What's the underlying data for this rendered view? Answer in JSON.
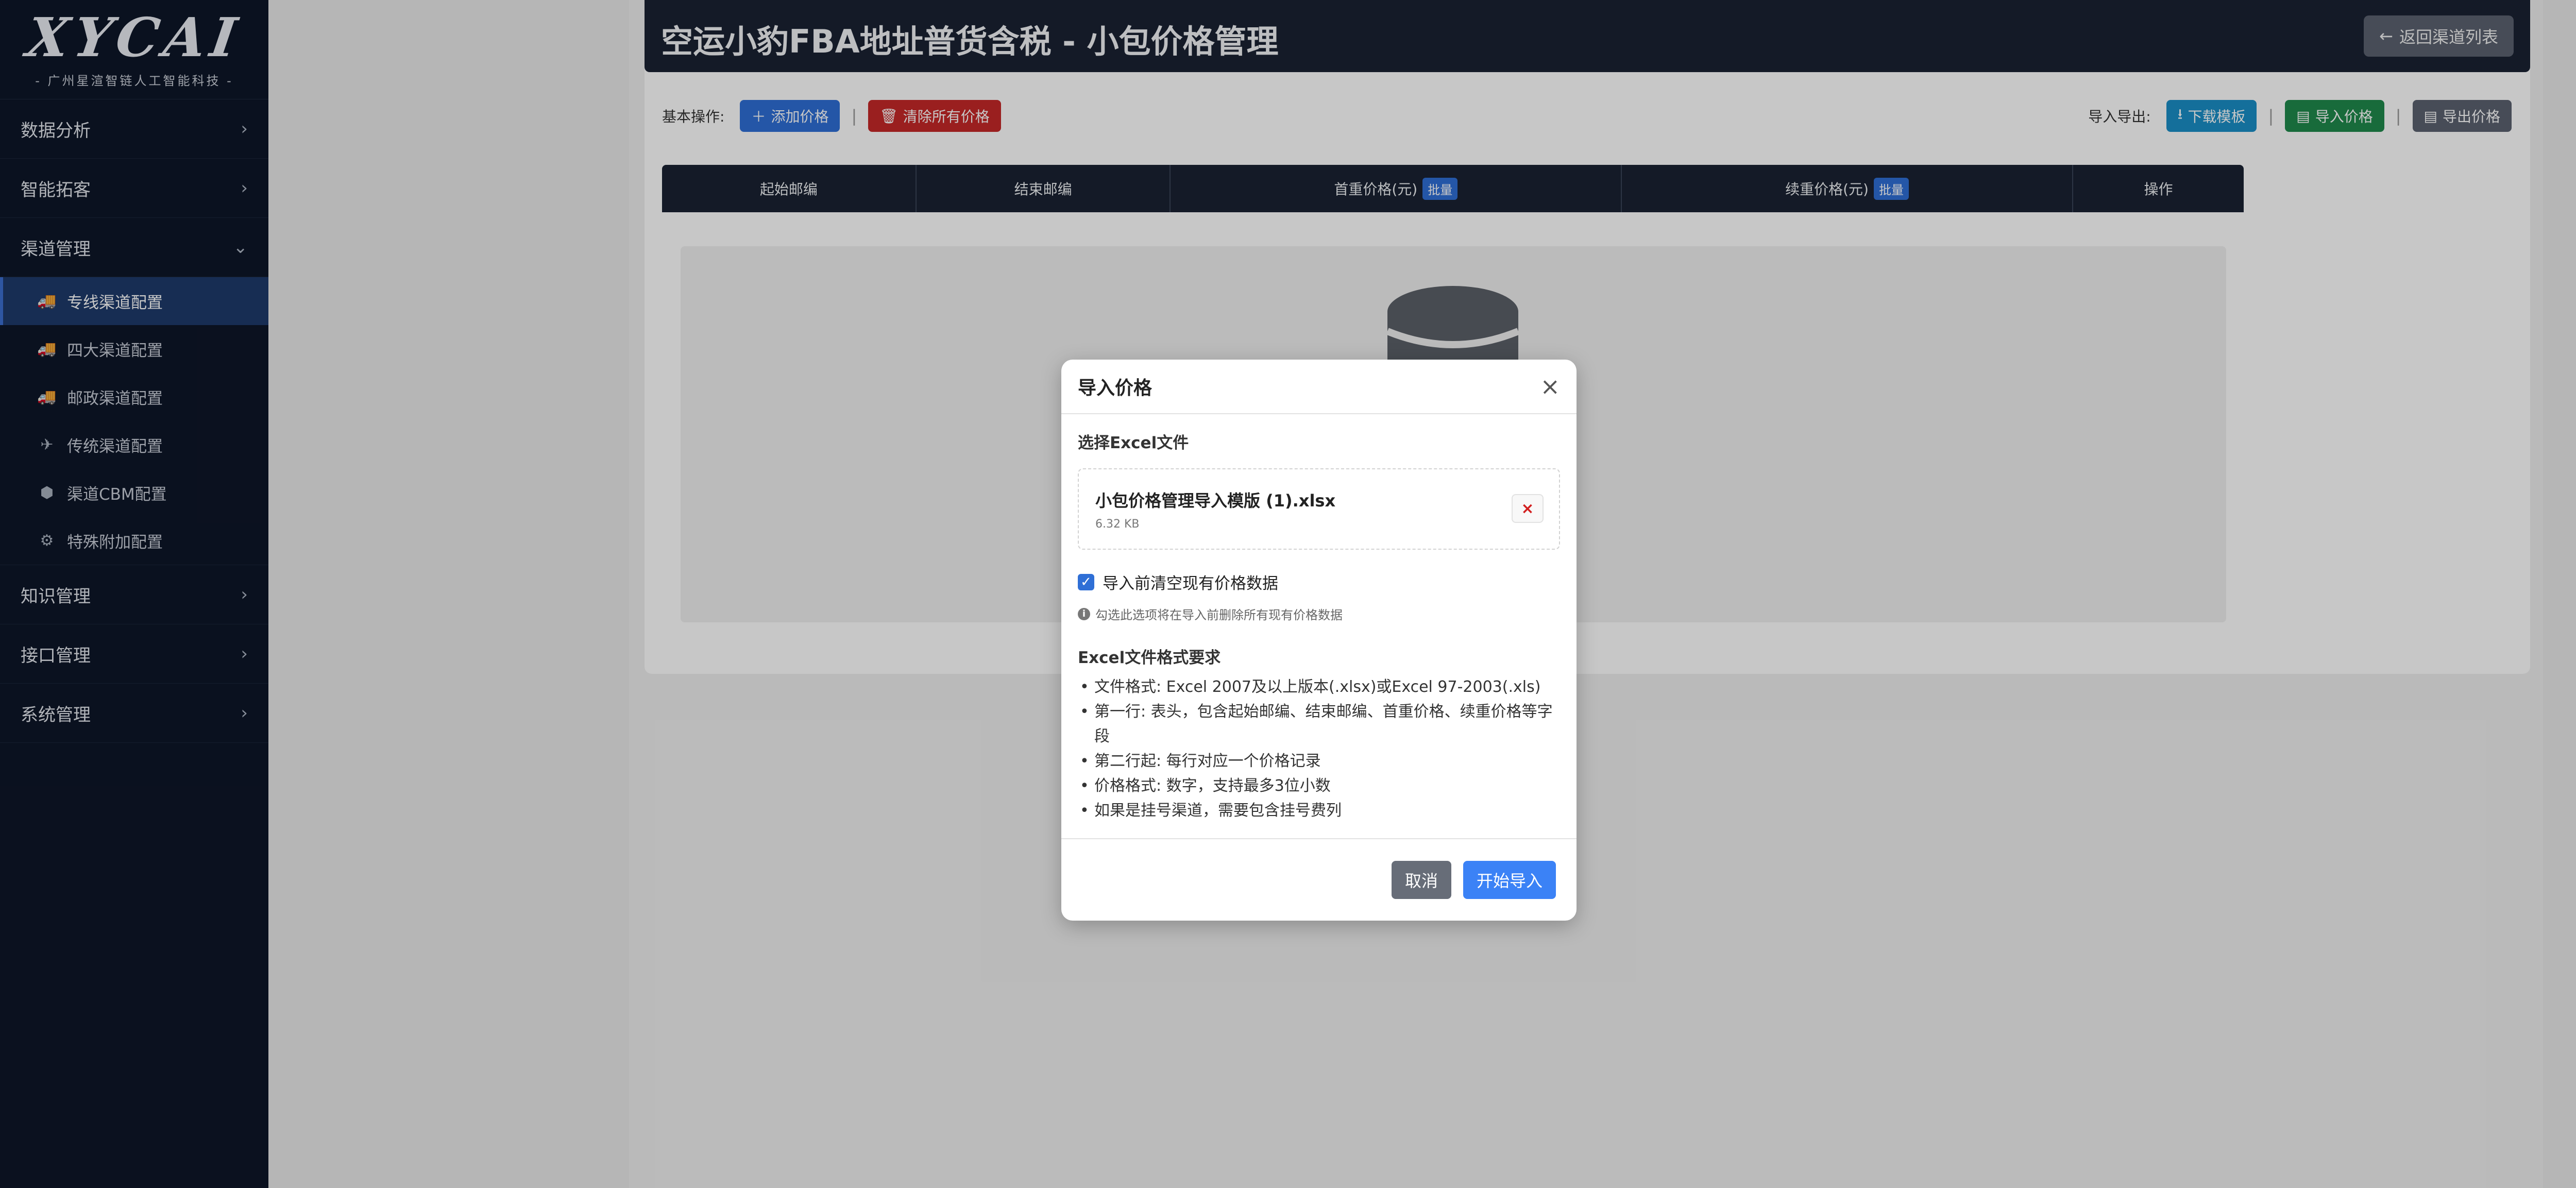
{
  "sidebar": {
    "logo": {
      "mark": "XYCAI",
      "subtitle": "- 广州星渲智链人工智能科技 -"
    },
    "groups": [
      {
        "label": "数据分析",
        "chevron": "›"
      },
      {
        "label": "智能拓客",
        "chevron": "›"
      },
      {
        "label": "渠道管理",
        "chevron": "⌄"
      }
    ],
    "sub_items": [
      {
        "label": "专线渠道配置",
        "icon": "🚚",
        "icon_name": "truck-icon"
      },
      {
        "label": "四大渠道配置",
        "icon": "🚚",
        "icon_name": "truck-icon"
      },
      {
        "label": "邮政渠道配置",
        "icon": "🚚",
        "icon_name": "truck-icon"
      },
      {
        "label": "传统渠道配置",
        "icon": "✈",
        "icon_name": "plane-icon"
      },
      {
        "label": "渠道CBM配置",
        "icon": "⬢",
        "icon_name": "box-icon"
      },
      {
        "label": "特殊附加配置",
        "icon": "⚙",
        "icon_name": "gear-icon"
      }
    ],
    "bottom_groups": [
      {
        "label": "知识管理",
        "chevron": "›"
      },
      {
        "label": "接口管理",
        "chevron": "›"
      },
      {
        "label": "系统管理",
        "chevron": "›"
      }
    ]
  },
  "header": {
    "title": "空运小豹FBA地址普货含税 - 小包价格管理",
    "back_label": "返回渠道列表",
    "back_icon": "←"
  },
  "toolbar": {
    "basic_label": "基本操作:",
    "add_label": "添加价格",
    "clear_label": "清除所有价格",
    "io_label": "导入导出:",
    "download_label": "下载模板",
    "import_label": "导入价格",
    "export_label": "导出价格",
    "separator": "|"
  },
  "table": {
    "columns": [
      {
        "label": "起始邮编",
        "badge": ""
      },
      {
        "label": "结束邮编",
        "badge": ""
      },
      {
        "label": "首重价格(元)",
        "badge": "批量"
      },
      {
        "label": "续重价格(元)",
        "badge": "批量"
      },
      {
        "label": "操作",
        "badge": ""
      }
    ]
  },
  "modal": {
    "title": "导入价格",
    "close": "×",
    "file_section_label": "选择Excel文件",
    "file_name": "小包价格管理导入模版 (1).xlsx",
    "file_size": "6.32 KB",
    "remove": "×",
    "clear_checkbox_label": "导入前清空现有价格数据",
    "checkbox_mark": "✓",
    "hint_icon": "i",
    "hint": "勾选此选项将在导入前删除所有现有价格数据",
    "requirements_title": "Excel文件格式要求",
    "requirements": [
      "文件格式: Excel 2007及以上版本(.xlsx)或Excel 97-2003(.xls)",
      "第一行: 表头，包含起始邮编、结束邮编、首重价格、续重价格等字段",
      "第二行起: 每行对应一个价格记录",
      "价格格式: 数字，支持最多3位小数",
      "如果是挂号渠道，需要包含挂号费列"
    ],
    "cancel_label": "取消",
    "start_label": "开始导入"
  }
}
